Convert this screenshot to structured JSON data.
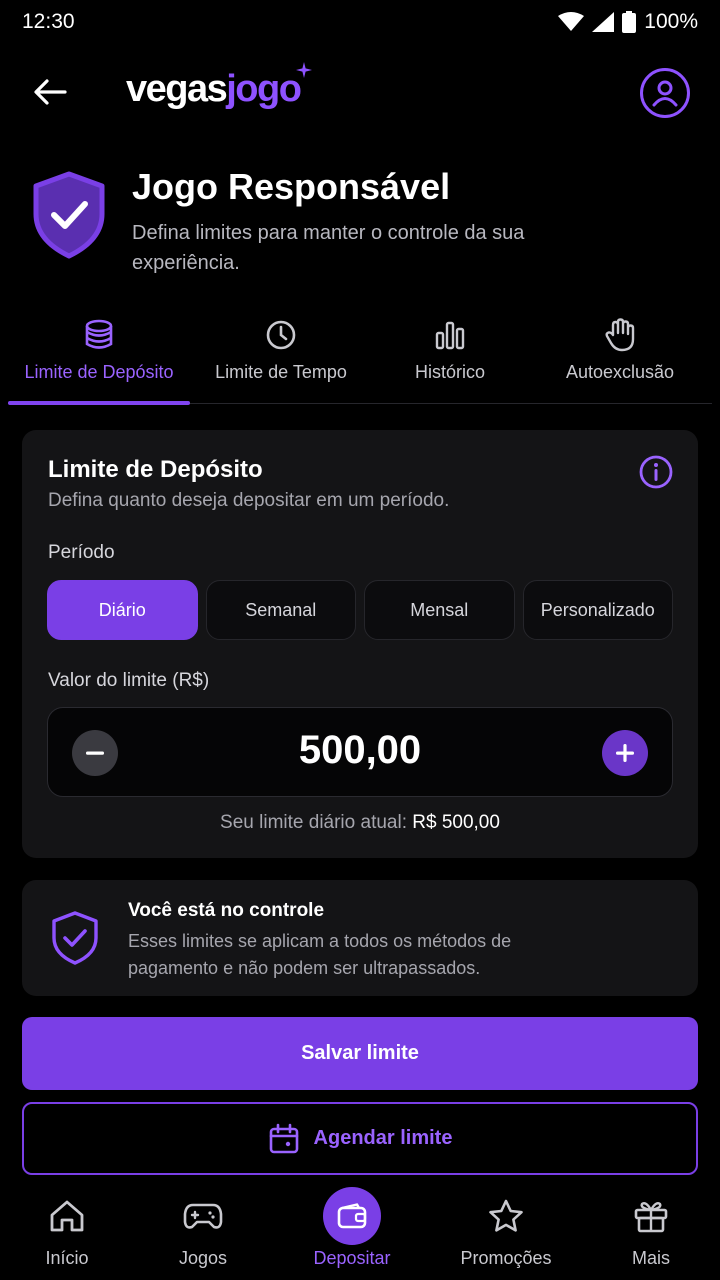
{
  "status_bar": {
    "time": "12:30",
    "battery": "100%"
  },
  "header": {
    "logo_part1": "vegas",
    "logo_part2": "jogo"
  },
  "hero": {
    "title": "Jogo Responsável",
    "subtitle": "Defina limites para manter o controle da sua experiência."
  },
  "tabs": [
    {
      "label": "Limite de Depósito",
      "icon": "coins-stack-icon",
      "active": true
    },
    {
      "label": "Limite de Tempo",
      "icon": "clock-icon",
      "active": false
    },
    {
      "label": "Histórico",
      "icon": "bar-chart-icon",
      "active": false
    },
    {
      "label": "Autoexclusão",
      "icon": "hand-stop-icon",
      "active": false
    }
  ],
  "limit_card": {
    "title": "Limite de Depósito",
    "subtitle": "Defina quanto deseja depositar em um período.",
    "period_label": "Período",
    "periods": [
      "Diário",
      "Semanal",
      "Mensal",
      "Personalizado"
    ],
    "selected_period": "Diário",
    "value_label": "Valor do limite (R$)",
    "value": "500,00",
    "current_limit_prefix": "Seu limite diário atual:",
    "current_limit_value": "R$ 500,00"
  },
  "notice": {
    "title": "Você está no controle",
    "text": "Esses limites se aplicam a todos os métodos de pagamento e não podem ser ultrapassados."
  },
  "actions": {
    "save_label": "Salvar limite",
    "schedule_label": "Agendar limite"
  },
  "bottom_nav": [
    {
      "label": "Início",
      "icon": "home-icon",
      "active": false
    },
    {
      "label": "Jogos",
      "icon": "gamepad-icon",
      "active": false
    },
    {
      "label": "Depositar",
      "icon": "wallet-icon",
      "active": true
    },
    {
      "label": "Promoções",
      "icon": "star-icon",
      "active": false
    },
    {
      "label": "Mais",
      "icon": "gift-icon",
      "active": false
    }
  ],
  "colors": {
    "accent": "#7a3fe6",
    "accent_text": "#9a63ff",
    "background": "#000000",
    "card": "#141416"
  }
}
